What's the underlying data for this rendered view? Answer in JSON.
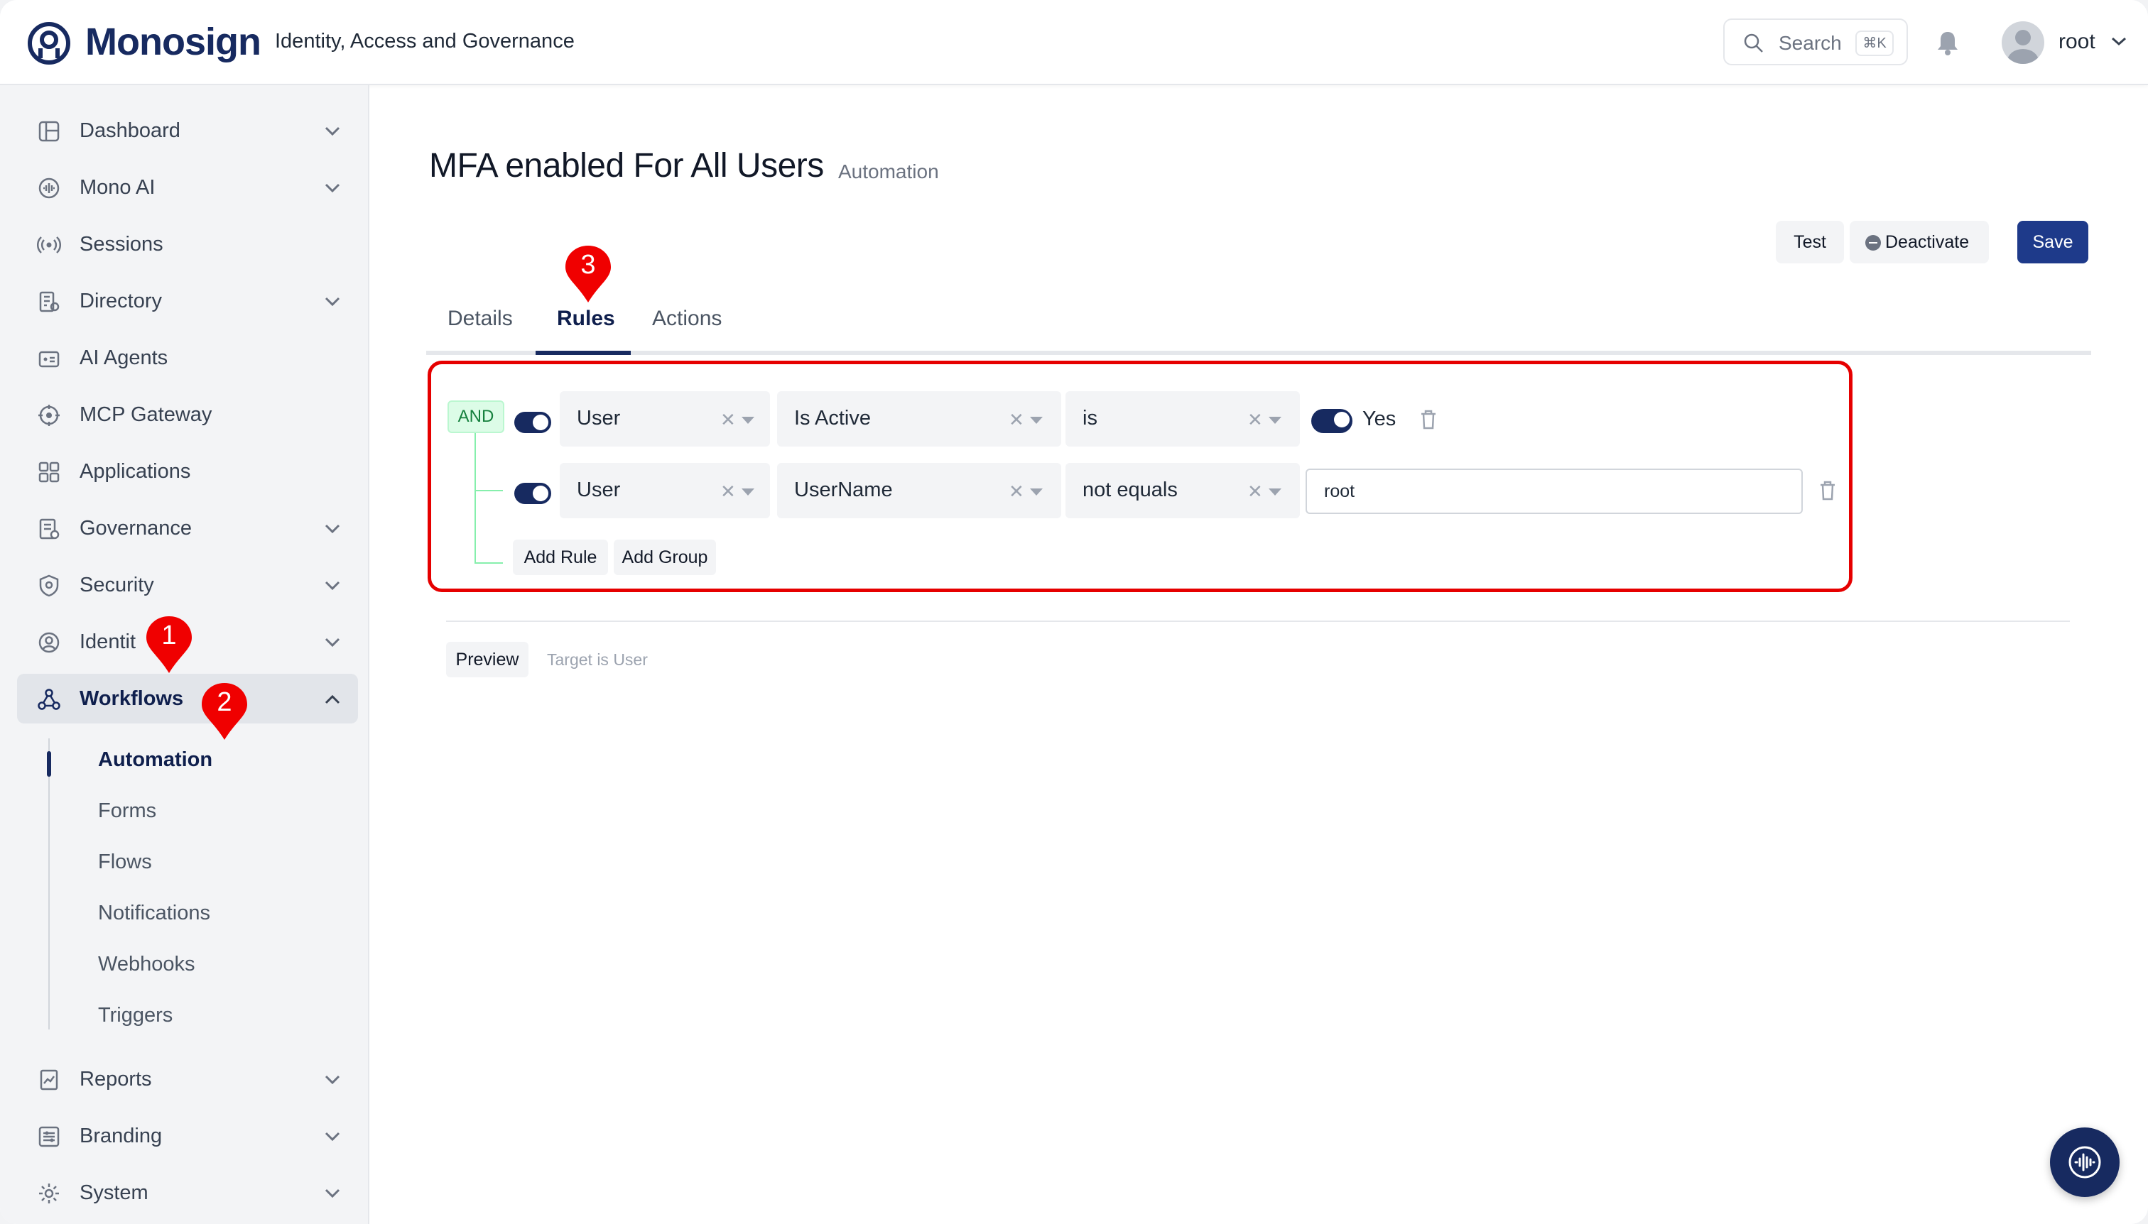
{
  "header": {
    "brand": "Monosign",
    "tagline": "Identity, Access and Governance",
    "search_label": "Search",
    "search_shortcut": "⌘K",
    "user_name": "root"
  },
  "sidebar": {
    "items": [
      {
        "label": "Dashboard",
        "icon": "dashboard-icon"
      },
      {
        "label": "Mono AI",
        "icon": "mono-ai-icon"
      },
      {
        "label": "Sessions",
        "icon": "sessions-icon"
      },
      {
        "label": "Directory",
        "icon": "directory-icon"
      },
      {
        "label": "AI Agents",
        "icon": "ai-agents-icon"
      },
      {
        "label": "MCP Gateway",
        "icon": "mcp-gateway-icon"
      },
      {
        "label": "Applications",
        "icon": "applications-icon"
      },
      {
        "label": "Governance",
        "icon": "governance-icon"
      },
      {
        "label": "Security",
        "icon": "security-icon"
      },
      {
        "label": "Identit",
        "icon": "identity-icon"
      },
      {
        "label": "Workflows",
        "icon": "workflows-icon"
      },
      {
        "label": "Reports",
        "icon": "reports-icon"
      },
      {
        "label": "Branding",
        "icon": "branding-icon"
      },
      {
        "label": "System",
        "icon": "system-icon"
      }
    ],
    "workflows_sub": [
      "Automation",
      "Forms",
      "Flows",
      "Notifications",
      "Webhooks",
      "Triggers"
    ]
  },
  "page": {
    "title": "MFA enabled For All Users",
    "subtitle": "Automation",
    "buttons": {
      "test": "Test",
      "deactivate": "Deactivate",
      "save": "Save"
    },
    "tabs": [
      "Details",
      "Rules",
      "Actions"
    ]
  },
  "rules": {
    "combinator": "AND",
    "rows": [
      {
        "entity": "User",
        "field": "Is Active",
        "operator": "is",
        "value_label": "Yes",
        "enabled": true
      },
      {
        "entity": "User",
        "field": "UserName",
        "operator": "not equals",
        "value": "root",
        "enabled": true
      }
    ],
    "add_rule": "Add Rule",
    "add_group": "Add Group"
  },
  "preview": {
    "button": "Preview",
    "note": "Target is User"
  },
  "markers": [
    "1",
    "2",
    "3"
  ],
  "colors": {
    "brand": "#172a60",
    "accent": "#1e3a8a",
    "highlight": "#e60000",
    "and_badge": "#15803d"
  }
}
